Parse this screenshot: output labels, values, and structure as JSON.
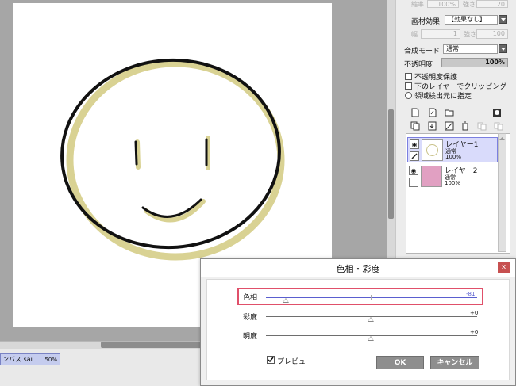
{
  "canvas": {
    "document_tab": {
      "name": "ンバス.sai",
      "zoom": "50%"
    }
  },
  "panel": {
    "top_row": {
      "left_label": "縮率",
      "left_value": "100%",
      "right_label": "強さ",
      "right_value": "20"
    },
    "texture": {
      "label": "画材効果",
      "value": "【効果なし】"
    },
    "texture_sub": {
      "left_label": "幅",
      "left_value": "1",
      "right_label": "強さ",
      "right_value": "100"
    },
    "blend_mode": {
      "label": "合成モード",
      "value": "通常"
    },
    "opacity": {
      "label": "不透明度",
      "value": "100%"
    },
    "checkboxes": [
      {
        "label": "不透明度保護",
        "checked": false
      },
      {
        "label": "下のレイヤーでクリッピング",
        "checked": false
      }
    ],
    "radio": {
      "label": "領域検出元に指定"
    },
    "layers": [
      {
        "name": "レイヤー1",
        "mode": "通常",
        "opacity": "100%",
        "selected": true,
        "thumb_color": "#ffffff"
      },
      {
        "name": "レイヤー2",
        "mode": "通常",
        "opacity": "100%",
        "selected": false,
        "thumb_color": "#e1a0c2"
      }
    ],
    "tool_icons": [
      "new-layer-icon",
      "new-vector-layer-icon",
      "new-folder-icon",
      "mask-icon",
      "copy-layer-icon",
      "merge-down-icon",
      "clear-layer-icon",
      "delete-layer-icon",
      "transfer-layer-icon",
      "merge-layer-icon"
    ]
  },
  "dialog": {
    "title": "色相・彩度",
    "close_label": "x",
    "sliders": [
      {
        "label": "色相",
        "value": "-81",
        "level": -81
      },
      {
        "label": "彩度",
        "value": "+0",
        "level": 0
      },
      {
        "label": "明度",
        "value": "+0",
        "level": 0
      }
    ],
    "preview": {
      "label": "プレビュー",
      "checked": true
    },
    "ok_label": "OK",
    "cancel_label": "キャンセル"
  },
  "colors": {
    "accent_highlight": "#e0506a",
    "hue_line": "#5a5fcf",
    "face_stroke": "#111111",
    "face_fill": "#d9d293",
    "layer_selected": "#d9dbfb"
  }
}
